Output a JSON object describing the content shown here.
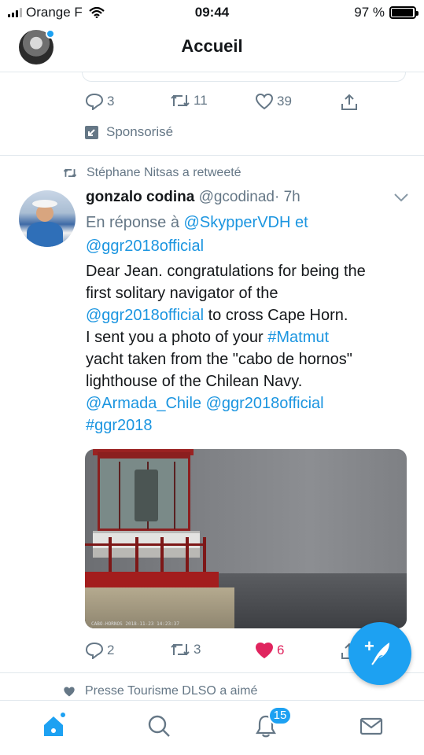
{
  "status_bar": {
    "carrier": "Orange F",
    "time": "09:44",
    "battery_percent": "97 %",
    "battery_level": 0.97
  },
  "header": {
    "title": "Accueil"
  },
  "previous_tweet": {
    "replies": "3",
    "retweets": "11",
    "likes": "39",
    "sponsored_label": "Sponsorisé"
  },
  "retweet_context": "Stéphane Nitsas a retweeté",
  "tweet": {
    "name": "gonzalo codina",
    "handle": "@gcodinad",
    "time": "· 7h",
    "reply_prefix": "En réponse à",
    "reply_user_1": "@SkypperVDH",
    "reply_et": "et",
    "reply_user_2": "@ggr2018official",
    "text": {
      "l1": "Dear Jean. congratulations for being the",
      "l2": "first solitary navigator of the",
      "l3_link": "@ggr2018official",
      "l3_rest": " to cross Cape Horn.",
      "l4_start": "I sent you a photo of your ",
      "l4_link": "#Matmut",
      "l5": "yacht taken from the \"cabo de hornos\"",
      "l6": "lighthouse of the Chilean Navy.",
      "l7_link1": "@Armada_Chile",
      "l7_link2": "@ggr2018official",
      "l8_link": "#ggr2018"
    },
    "media_caption": "CABO-HORNOS 2018-11-23 14:23:37",
    "replies": "2",
    "retweets": "3",
    "likes": "6"
  },
  "like_context": "Presse Tourisme DLSO a aimé",
  "tabbar": {
    "notifications_badge": "15"
  },
  "colors": {
    "accent": "#1da1f2",
    "link": "#1b95e0",
    "liked": "#e0245e",
    "secondary_text": "#657786"
  },
  "icons": [
    "signal-icon",
    "wifi-icon",
    "battery-icon",
    "reply-icon",
    "retweet-icon",
    "heart-icon",
    "share-icon",
    "sponsored-icon",
    "chevron-down-icon",
    "compose-icon",
    "home-icon",
    "search-icon",
    "bell-icon",
    "mail-icon"
  ]
}
